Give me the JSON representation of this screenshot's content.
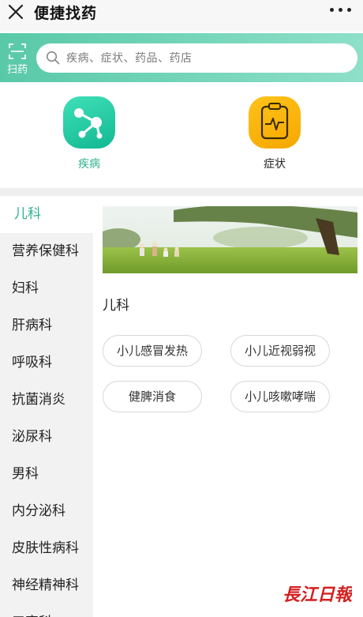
{
  "header": {
    "title": "便捷找药"
  },
  "search": {
    "scan_label": "扫药",
    "placeholder": "疾病、症状、药品、药店"
  },
  "shortcuts": [
    {
      "label": "疾病",
      "icon": "share-nodes-icon",
      "color": "#1fc7a0"
    },
    {
      "label": "症状",
      "icon": "clipboard-pulse-icon",
      "color": "#f5b400"
    }
  ],
  "sidebar": {
    "items": [
      {
        "label": "儿科",
        "active": true
      },
      {
        "label": "营养保健科"
      },
      {
        "label": "妇科"
      },
      {
        "label": "肝病科"
      },
      {
        "label": "呼吸科"
      },
      {
        "label": "抗菌消炎"
      },
      {
        "label": "泌尿科"
      },
      {
        "label": "男科"
      },
      {
        "label": "内分泌科"
      },
      {
        "label": "皮肤性病科"
      },
      {
        "label": "神经精神科"
      },
      {
        "label": "五官科"
      }
    ]
  },
  "main": {
    "section_title": "儿科",
    "tags": [
      {
        "label": "小儿感冒发热"
      },
      {
        "label": "小儿近视弱视"
      },
      {
        "label": "健脾消食"
      },
      {
        "label": "小儿咳嗽哮喘"
      }
    ]
  },
  "watermark": {
    "text": "长江日报"
  },
  "colors": {
    "accent": "#2fb38b",
    "search_strip": "#6fd3b6",
    "sidebar_bg": "#f2f2f2"
  }
}
